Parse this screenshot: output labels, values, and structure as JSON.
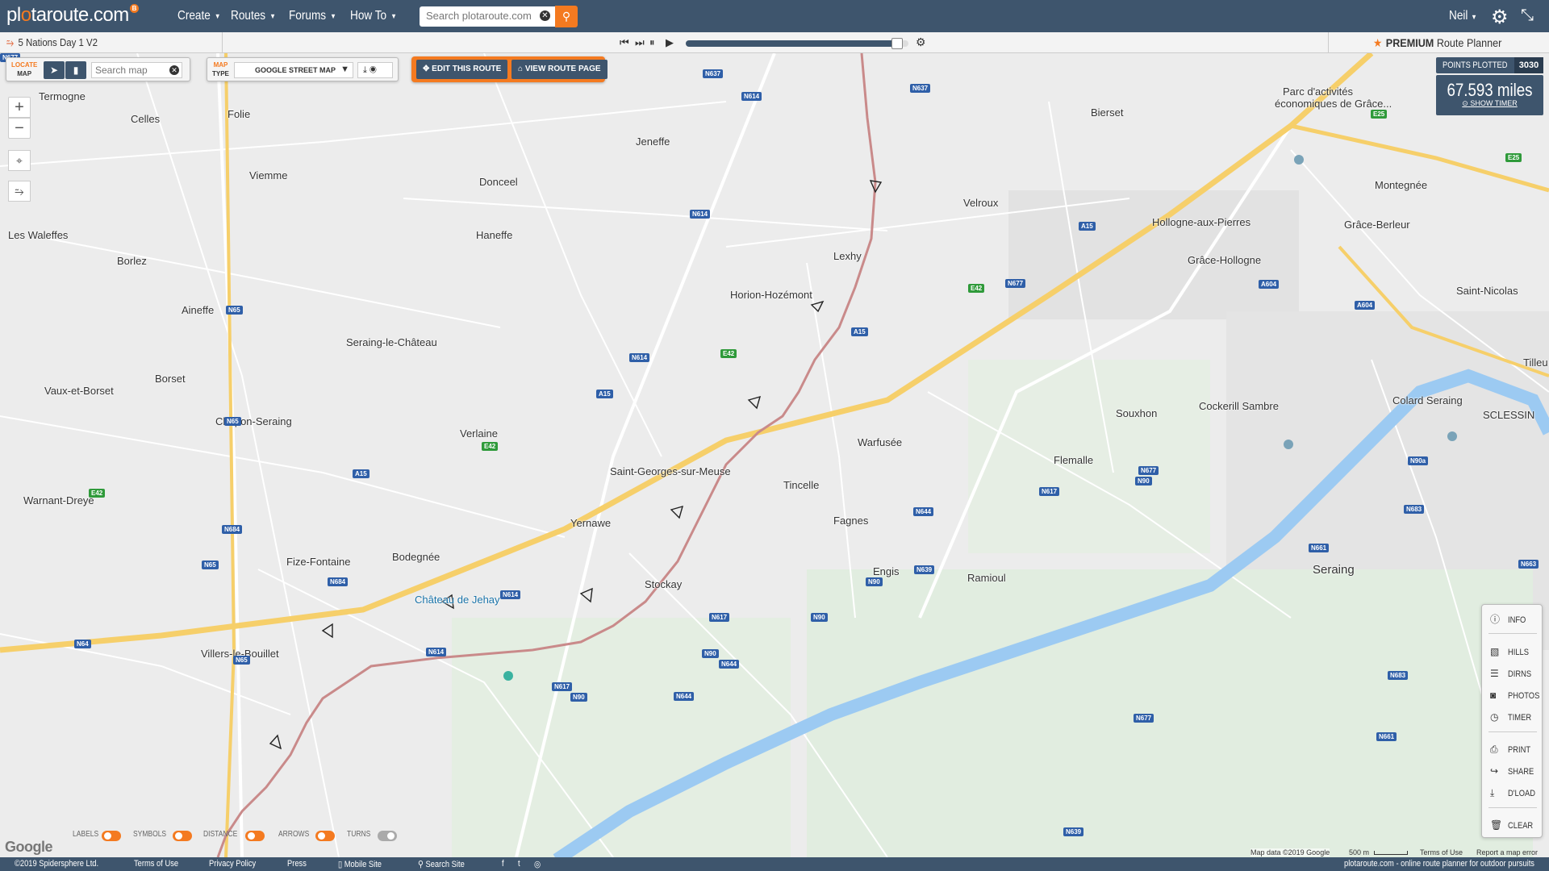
{
  "header": {
    "logo_text_a": "pl",
    "logo_text_o": "o",
    "logo_text_b": "taroute.com",
    "logo_badge": "B",
    "nav": [
      {
        "label": "Create"
      },
      {
        "label": "Routes"
      },
      {
        "label": "Forums"
      },
      {
        "label": "How To"
      }
    ],
    "search_placeholder": "Search plotaroute.com",
    "user_name": "Neil",
    "icons": [
      "search-icon",
      "gear-icon",
      "collapse-icon"
    ]
  },
  "subbar": {
    "route_name": "5 Nations Day 1 V2",
    "progress_fraction": 0.95,
    "premium_strong": "PREMIUM",
    "premium_rest": "Route Planner"
  },
  "tools": {
    "locate_label_a": "LOCATE",
    "locate_label_b": "MAP",
    "search_map_placeholder": "Search map",
    "map_type_label_a": "MAP",
    "map_type_label_b": "TYPE",
    "map_type_value": "GOOGLE STREET MAP",
    "edit_route": "EDIT THIS ROUTE",
    "view_route": "VIEW ROUTE PAGE"
  },
  "stats": {
    "points_label": "POINTS PLOTTED",
    "points_value": "3030",
    "distance": "67.593 miles",
    "show_timer": "SHOW TIMER"
  },
  "side_panel": {
    "items": [
      {
        "label": "INFO",
        "icon": "info-icon"
      },
      {
        "label": "HILLS",
        "icon": "hills-icon"
      },
      {
        "label": "DIRNS",
        "icon": "directions-icon"
      },
      {
        "label": "PHOTOS",
        "icon": "camera-icon"
      },
      {
        "label": "TIMER",
        "icon": "clock-icon"
      },
      {
        "label": "PRINT",
        "icon": "print-icon"
      },
      {
        "label": "SHARE",
        "icon": "share-icon"
      },
      {
        "label": "D'LOAD",
        "icon": "download-icon"
      },
      {
        "label": "CLEAR",
        "icon": "trash-icon"
      }
    ]
  },
  "toggles": [
    {
      "label": "LABELS",
      "on": true
    },
    {
      "label": "SYMBOLS",
      "on": true
    },
    {
      "label": "DISTANCE",
      "on": true
    },
    {
      "label": "ARROWS",
      "on": true
    },
    {
      "label": "TURNS",
      "on": false
    }
  ],
  "map": {
    "google_logo": "Google",
    "attribution": "Map data ©2019 Google",
    "scale": "500 m",
    "terms": "Terms of Use",
    "report": "Report a map error",
    "places": [
      "Termogne",
      "Celles",
      "Folie",
      "Jeneffe",
      "Bierset",
      "Parc d'activités",
      "économiques de Grâce...",
      "Montegnée",
      "Viemme",
      "Donceel",
      "Velroux",
      "Hollogne-aux-Pierres",
      "Grâce-Berleur",
      "Les Waleffes",
      "Haneffe",
      "Lexhy",
      "Grâce-Hollogne",
      "Borlez",
      "Horion-Hozémont",
      "Saint-Nicolas",
      "Aineffe",
      "Seraing-le-Château",
      "Tilleu",
      "Borset",
      "Vaux-et-Borset",
      "Colard Seraing",
      "Cockerill Sambre",
      "Souxhon",
      "SCLESSIN",
      "Chapon-Seraing",
      "Verlaine",
      "Warfusée",
      "Flemalle",
      "Saint-Georges-sur-Meuse",
      "Tincelle",
      "Warnant-Dreye",
      "Yernawe",
      "Fagnes",
      "Fize-Fontaine",
      "Bodegnée",
      "Engis",
      "Ramioul",
      "Seraing",
      "Stockay",
      "Château de Jehay",
      "Villers-le-Bouillet"
    ],
    "roads": [
      "N637",
      "N614",
      "A15",
      "E42",
      "N65",
      "N684",
      "N64",
      "N617",
      "N90",
      "N644",
      "N639",
      "N677",
      "A604",
      "N683",
      "N661",
      "N663",
      "E25",
      "N90a"
    ]
  },
  "footer": {
    "copyright": "©2019 Spidersphere Ltd.",
    "terms": "Terms of Use",
    "privacy": "Privacy Policy",
    "press": "Press",
    "mobile": "Mobile Site",
    "search": "Search Site",
    "tagline": "plotaroute.com - online route planner for outdoor pursuits"
  },
  "colors": {
    "header": "#3e556d",
    "accent": "#f47a20",
    "route": "#c98a8a",
    "river": "#9ccaf2",
    "motorway": "#f6cf6a"
  }
}
